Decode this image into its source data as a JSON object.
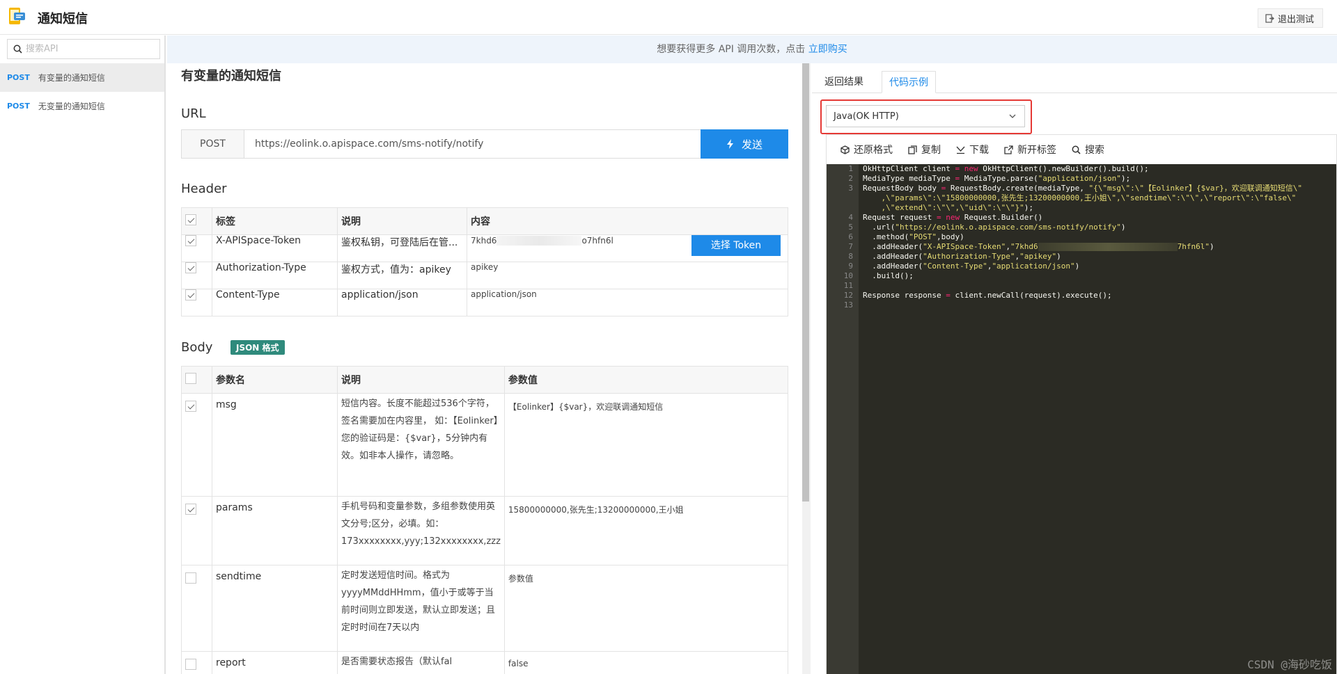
{
  "app": {
    "title": "通知短信",
    "logout_label": "退出测试"
  },
  "sidebar": {
    "search_placeholder": "搜索API",
    "items": [
      {
        "method": "POST",
        "name": "有变量的通知短信",
        "active": true
      },
      {
        "method": "POST",
        "name": "无变量的通知短信",
        "active": false
      }
    ]
  },
  "banner": {
    "text": "想要获得更多 API 调用次数，点击 ",
    "link": "立即购买"
  },
  "main": {
    "title": "有变量的通知短信",
    "url_section": "URL",
    "method": "POST",
    "url": "https://eolink.o.apispace.com/sms-notify/notify",
    "send_label": "发送",
    "header_section": "Header",
    "header_columns": [
      "标签",
      "说明",
      "内容"
    ],
    "headers": [
      {
        "checked": true,
        "name": "X-APISpace-Token",
        "desc": "鉴权私钥，可登陆后在管...",
        "value_prefix": "7khd6",
        "value_suffix": "o7hfn6l",
        "button": "选择 Token"
      },
      {
        "checked": true,
        "name": "Authorization-Type",
        "desc": "鉴权方式，值为：apikey",
        "value": "apikey"
      },
      {
        "checked": true,
        "name": "Content-Type",
        "desc": "application/json",
        "value": "application/json"
      }
    ],
    "body_section": "Body",
    "body_badge": "JSON 格式",
    "body_columns": [
      "参数名",
      "说明",
      "参数值"
    ],
    "params": [
      {
        "checked": true,
        "name": "msg",
        "desc": "短信内容。长度不能超过536个字符，签名需要加在内容里， 如：【Eolinker】您的验证码是：{$var}，5分钟内有效。如非本人操作，请忽略。",
        "value": "【Eolinker】{$var}，欢迎联调通知短信",
        "placeholder": false
      },
      {
        "checked": true,
        "name": "params",
        "desc": "手机号码和变量参数，多组参数使用英文分号;区分，必填。如：173xxxxxxxx,yyy;132xxxxxxxx,zzz",
        "value": "15800000000,张先生;13200000000,王小姐",
        "placeholder": false
      },
      {
        "checked": false,
        "name": "sendtime",
        "desc": "定时发送短信时间。格式为yyyyMMddHHmm，值小于或等于当前时间则立即发送，默认立即发送；且定时时间在7天以内",
        "value": "参数值",
        "placeholder": true
      },
      {
        "checked": false,
        "name": "report",
        "desc": "是否需要状态报告（默认fal",
        "value": "false",
        "placeholder": false
      }
    ]
  },
  "right": {
    "tabs": [
      "返回结果",
      "代码示例"
    ],
    "active_tab": 1,
    "language": "Java(OK HTTP)",
    "tools": [
      {
        "icon": "cube-icon",
        "label": "还原格式"
      },
      {
        "icon": "copy-icon",
        "label": "复制"
      },
      {
        "icon": "download-icon",
        "label": "下载"
      },
      {
        "icon": "external-link-icon",
        "label": "新开标签"
      },
      {
        "icon": "search-icon",
        "label": "搜索"
      }
    ],
    "line_numbers": [
      "1",
      "2",
      "3",
      "",
      "",
      "4",
      "5",
      "6",
      "7",
      "8",
      "9",
      "10",
      "11",
      "12",
      "13"
    ],
    "watermark": "CSDN @海砂吃饭"
  }
}
